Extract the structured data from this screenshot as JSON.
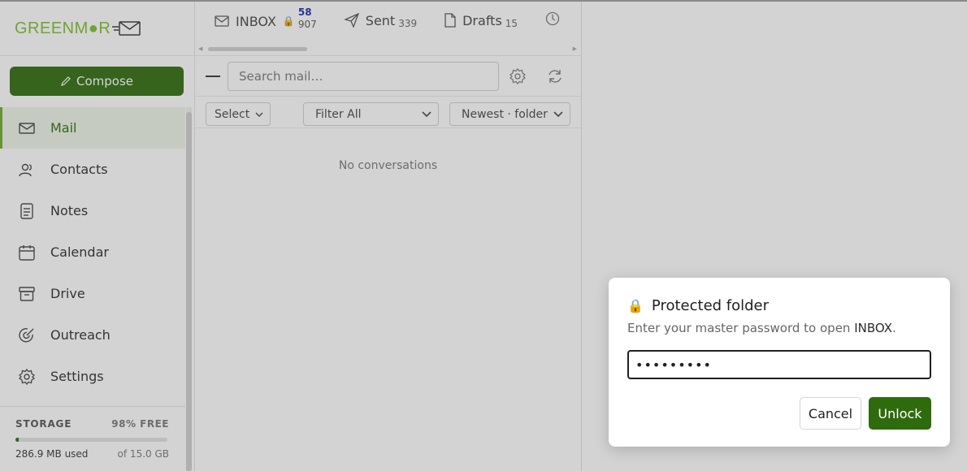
{
  "brand": {
    "name": "GREENMAIL",
    "logo_text": "GREENM●R",
    "accent": "#2e6b0c",
    "logo_color": "#7cbf2a"
  },
  "sidebar": {
    "compose_label": "Compose",
    "items": [
      {
        "label": "Mail",
        "icon": "mail-icon",
        "active": true
      },
      {
        "label": "Contacts",
        "icon": "contacts-icon"
      },
      {
        "label": "Notes",
        "icon": "notes-icon"
      },
      {
        "label": "Calendar",
        "icon": "calendar-icon"
      },
      {
        "label": "Drive",
        "icon": "drive-icon"
      },
      {
        "label": "Outreach",
        "icon": "outreach-icon"
      },
      {
        "label": "Settings",
        "icon": "gear-icon"
      }
    ],
    "storage": {
      "label": "STORAGE",
      "free": "98% FREE",
      "used": "286.9 MB used",
      "total": "of 15.0 GB",
      "used_fraction": 0.019
    }
  },
  "tabs": [
    {
      "label": "INBOX",
      "unread": "58",
      "total": "907",
      "locked": true
    },
    {
      "label": "Sent",
      "count": "339"
    },
    {
      "label": "Drafts",
      "count": "15"
    }
  ],
  "toolbar": {
    "search_placeholder": "Search mail…"
  },
  "filters": {
    "select_label": "Select",
    "filter_label": "Filter All",
    "sort_label": "Newest · folder"
  },
  "list": {
    "empty_text": "No conversations"
  },
  "dialog": {
    "title": "Protected folder",
    "desc_prefix": "Enter your master password to open ",
    "folder": "INBOX",
    "desc_suffix": ".",
    "password_value": "•••••••••",
    "cancel_label": "Cancel",
    "unlock_label": "Unlock"
  }
}
